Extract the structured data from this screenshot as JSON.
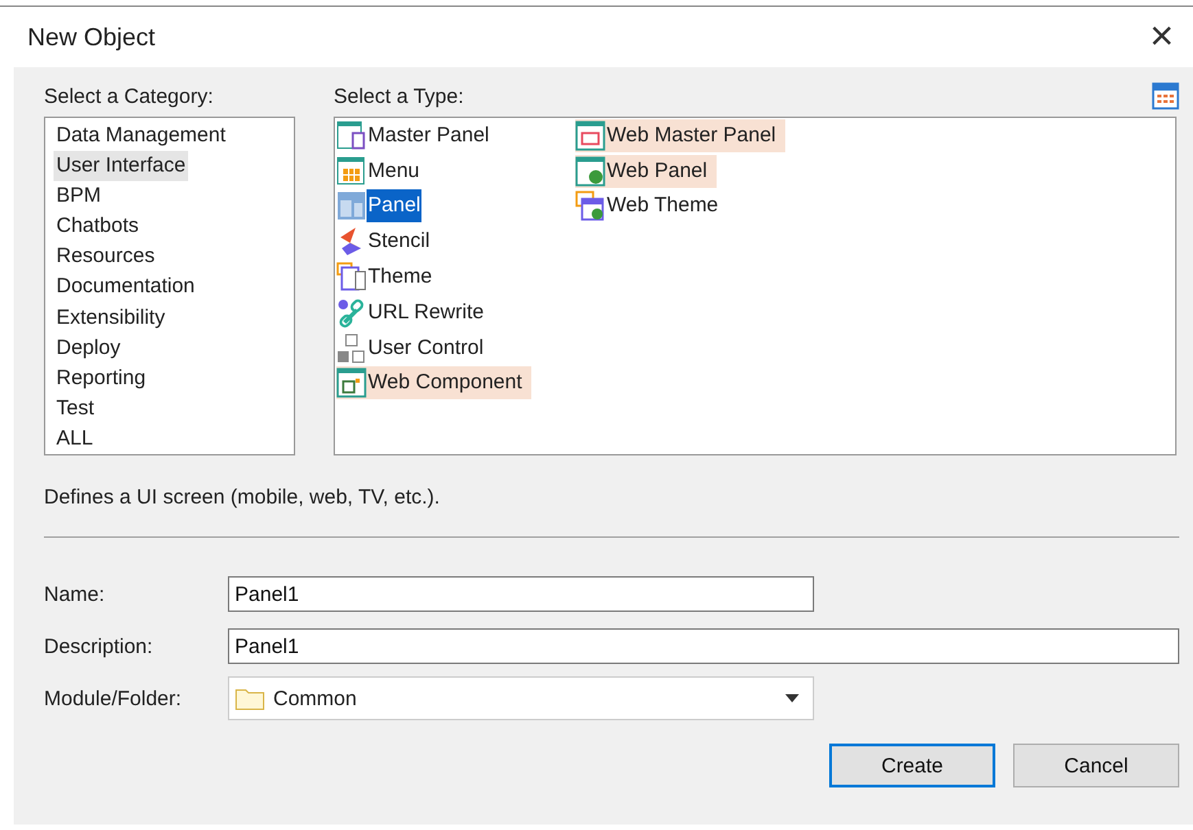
{
  "window": {
    "title": "New Object",
    "close": "×"
  },
  "category": {
    "label": "Select a Category:",
    "items": [
      {
        "label": "Data Management",
        "selected": false
      },
      {
        "label": "User Interface",
        "selected": true
      },
      {
        "label": "BPM",
        "selected": false
      },
      {
        "label": "Chatbots",
        "selected": false
      },
      {
        "label": "Resources",
        "selected": false
      },
      {
        "label": "Documentation",
        "selected": false
      },
      {
        "label": "Extensibility",
        "selected": false
      },
      {
        "label": "Deploy",
        "selected": false
      },
      {
        "label": "Reporting",
        "selected": false
      },
      {
        "label": "Test",
        "selected": false
      },
      {
        "label": "ALL",
        "selected": false
      }
    ]
  },
  "type": {
    "label": "Select a Type:",
    "items": [
      {
        "label": "Master Panel",
        "kind": "master",
        "selected": false,
        "highlighted": false
      },
      {
        "label": "Menu",
        "kind": "menu",
        "selected": false,
        "highlighted": false
      },
      {
        "label": "Panel",
        "kind": "panel",
        "selected": true,
        "highlighted": false
      },
      {
        "label": "Stencil",
        "kind": "stencil",
        "selected": false,
        "highlighted": false
      },
      {
        "label": "Theme",
        "kind": "theme",
        "selected": false,
        "highlighted": false
      },
      {
        "label": "URL Rewrite",
        "kind": "link",
        "selected": false,
        "highlighted": false
      },
      {
        "label": "User Control",
        "kind": "control",
        "selected": false,
        "highlighted": false
      },
      {
        "label": "Web Component",
        "kind": "component",
        "selected": false,
        "highlighted": true
      },
      {
        "label": "Web Master Panel",
        "kind": "webmaster",
        "selected": false,
        "highlighted": true
      },
      {
        "label": "Web Panel",
        "kind": "webpanel",
        "selected": false,
        "highlighted": true
      },
      {
        "label": "Web Theme",
        "kind": "webtheme",
        "selected": false,
        "highlighted": false
      }
    ]
  },
  "description": "Defines a UI screen (mobile, web, TV, etc.).",
  "fields": [
    {
      "label": "Name:",
      "value": "Panel1",
      "kind": "short"
    },
    {
      "label": "Description:",
      "value": "Panel1",
      "kind": "wide"
    },
    {
      "label": "Module/Folder:",
      "value": "Common",
      "kind": "folder"
    }
  ],
  "buttons": [
    {
      "label": "Create",
      "default": true
    },
    {
      "label": "Cancel",
      "default": false
    }
  ]
}
